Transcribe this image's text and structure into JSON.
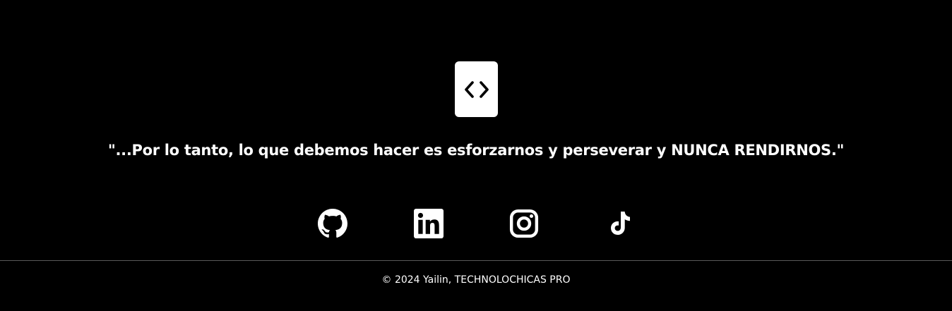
{
  "footer": {
    "logo_icon": "code-brackets-icon",
    "quote": "\"...Por lo tanto, lo que debemos hacer es esforzarnos y perseverar y NUNCA RENDIRNOS.\"",
    "socials": [
      {
        "icon": "github-icon"
      },
      {
        "icon": "linkedin-icon"
      },
      {
        "icon": "instagram-icon"
      },
      {
        "icon": "tiktok-icon"
      }
    ],
    "copyright": "© 2024 Yailin, TECHNOLOCHICAS PRO",
    "colors": {
      "background": "#000000",
      "foreground": "#ffffff",
      "divider": "#5a5a5a"
    }
  }
}
